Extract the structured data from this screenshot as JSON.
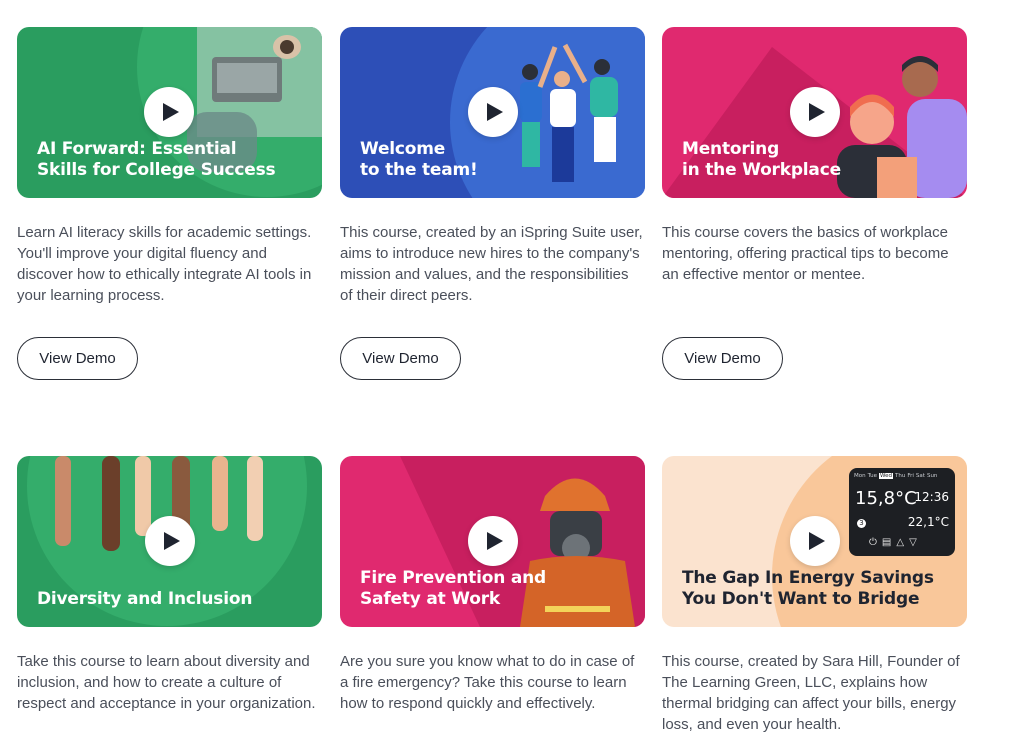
{
  "courses": [
    {
      "title": "AI Forward: Essential\nSkills for College Success",
      "description": "Learn AI literacy skills for academic settings. You'll improve your digital fluency and discover how to ethically integrate AI tools in your learning process.",
      "button": "View Demo",
      "bg_color": "#2a9d5f"
    },
    {
      "title": "Welcome\nto the team!",
      "description": "This course, created by an iSpring Suite user, aims to introduce new hires to the company's mission and values, and the responsibilities of their direct peers.",
      "button": "View Demo",
      "bg_color": "#2d4fb7"
    },
    {
      "title": "Mentoring\nin the Workplace",
      "description": "This course covers the basics of workplace mentoring, offering practical tips to become an effective mentor or mentee.",
      "button": "View Demo",
      "bg_color": "#e0296f"
    },
    {
      "title": "Diversity and Inclusion",
      "description": "Take this course to learn about diversity and inclusion, and how to create a culture of respect and acceptance in your organization.",
      "bg_color": "#2a9d5f"
    },
    {
      "title": "Fire Prevention and\nSafety at Work",
      "description": "Are you sure you know what to do in case of a fire emergency? Take this course to learn how to respond quickly and effectively.",
      "bg_color": "#e0296f"
    },
    {
      "title": "The Gap In Energy Savings\nYou Don't Want to Bridge",
      "description": "This course, created by Sara Hill, Founder of The Learning Green, LLC, explains how thermal bridging can affect your bills, energy loss, and even your health.",
      "bg_color": "#fbe3cf",
      "thermostat": {
        "days": "Mon Tue Wed Thu Fri Sat Sun",
        "active_day": "Wed",
        "temp_main": "15,8°C",
        "time": "12:36",
        "temp_set": "22,1°C",
        "indicator": "3"
      }
    }
  ]
}
